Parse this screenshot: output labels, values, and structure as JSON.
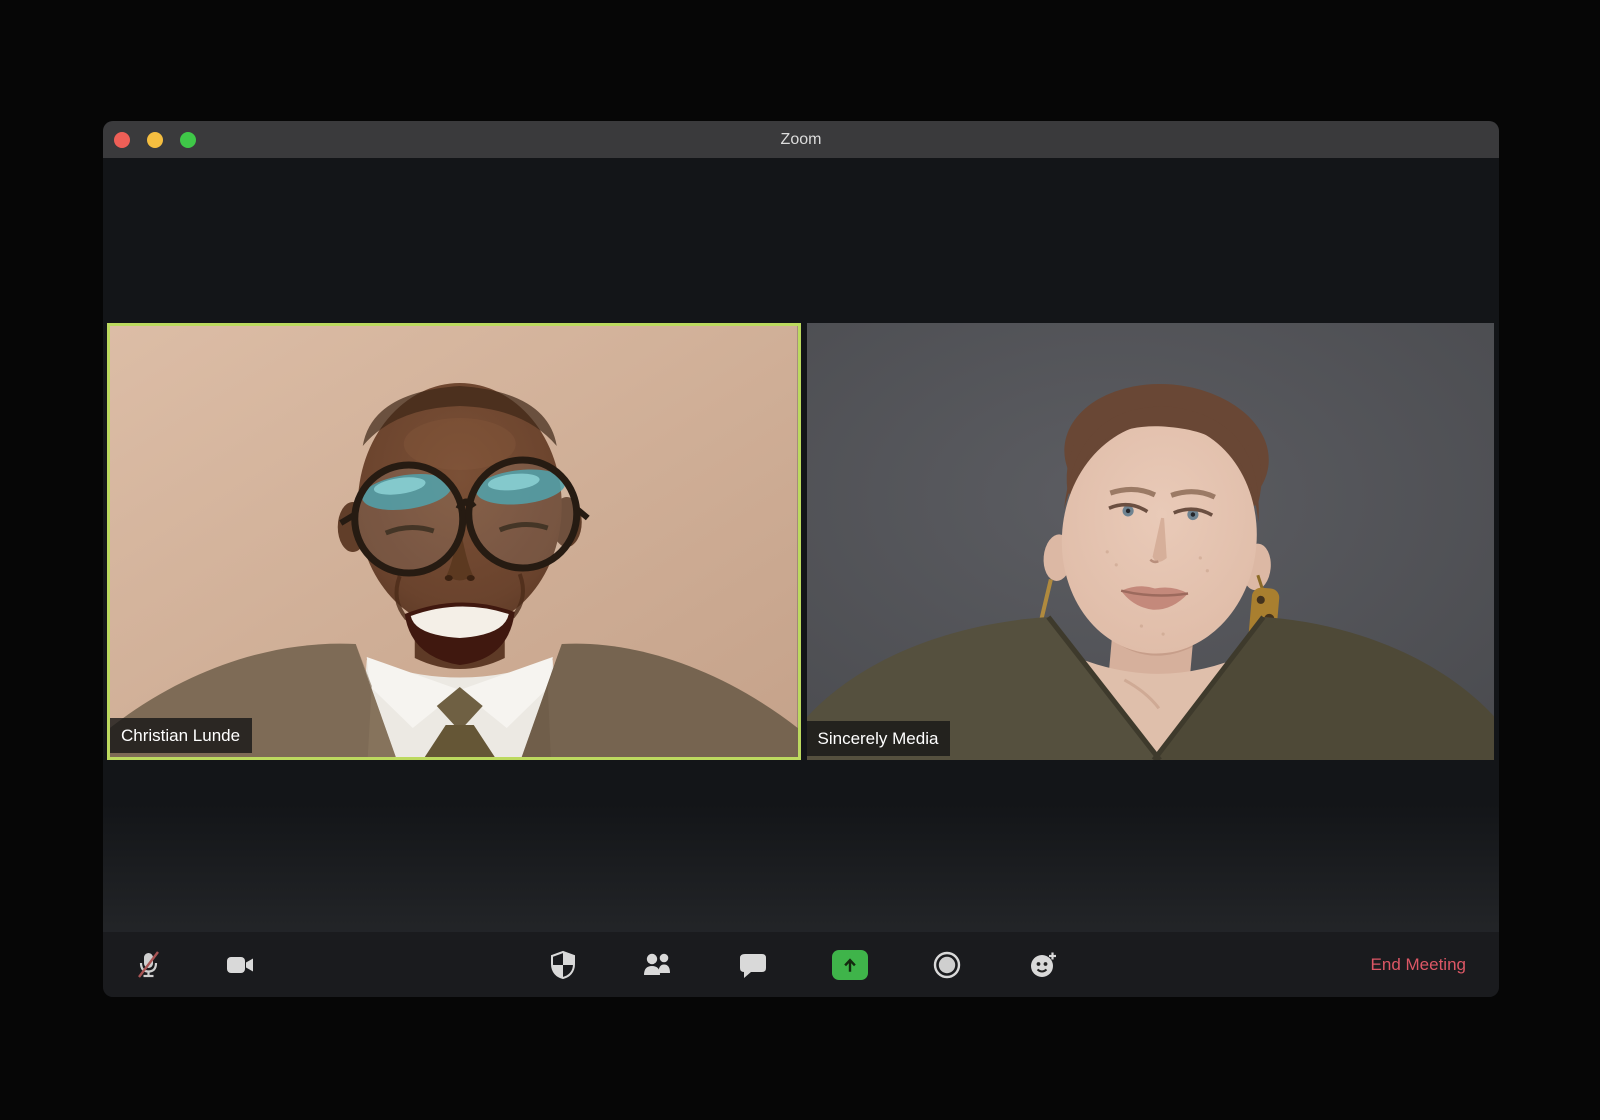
{
  "window": {
    "title": "Zoom"
  },
  "titlebar": {
    "traffic_lights": [
      "close",
      "minimize",
      "fullscreen"
    ]
  },
  "participants": [
    {
      "name": "Christian Lunde",
      "active_speaker": true
    },
    {
      "name": "Sincerely Media",
      "active_speaker": false
    }
  ],
  "toolbar": {
    "icons": [
      "microphone-muted-icon",
      "video-camera-icon",
      "security-shield-icon",
      "participants-icon",
      "chat-icon",
      "share-screen-icon",
      "record-icon",
      "reactions-icon"
    ],
    "end_meeting_label": "End Meeting"
  },
  "colors": {
    "active_speaker_border": "#bcd95f",
    "share_screen_green": "#3fb44a",
    "end_meeting_red": "#dc5765",
    "traffic_red": "#ee5f57",
    "traffic_yellow": "#f5be40",
    "traffic_green": "#3fc748",
    "titlebar_gray": "#3a3a3c",
    "window_background": "#131518",
    "toolbar_background": "#1a1b1e"
  }
}
